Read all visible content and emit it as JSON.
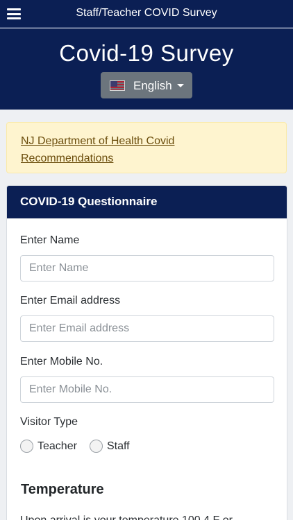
{
  "topbar": {
    "title": "Staff/Teacher COVID Survey",
    "menu_icon": "hamburger-menu-icon"
  },
  "hero": {
    "title": "Covid-19 Survey"
  },
  "language": {
    "selected": "English",
    "flag_icon": "us-flag-icon"
  },
  "alert": {
    "link_text": "NJ Department of Health Covid Recommendations"
  },
  "questionnaire": {
    "title": "COVID-19 Questionnaire",
    "fields": {
      "name": {
        "label": "Enter Name",
        "placeholder": "Enter Name"
      },
      "email": {
        "label": "Enter Email address",
        "placeholder": "Enter Email address"
      },
      "mobile": {
        "label": "Enter Mobile No.",
        "placeholder": "Enter Mobile No."
      }
    },
    "visitor_type": {
      "label": "Visitor Type",
      "options": [
        "Teacher",
        "Staff"
      ]
    },
    "temperature": {
      "title": "Temperature",
      "question": "Upon arrival is your temperature 100.4 F or"
    }
  },
  "colors": {
    "navy": "#0b1f54",
    "button_gray": "#6c757d",
    "alert_bg": "#fef4cf",
    "alert_text": "#6b4d0c"
  }
}
